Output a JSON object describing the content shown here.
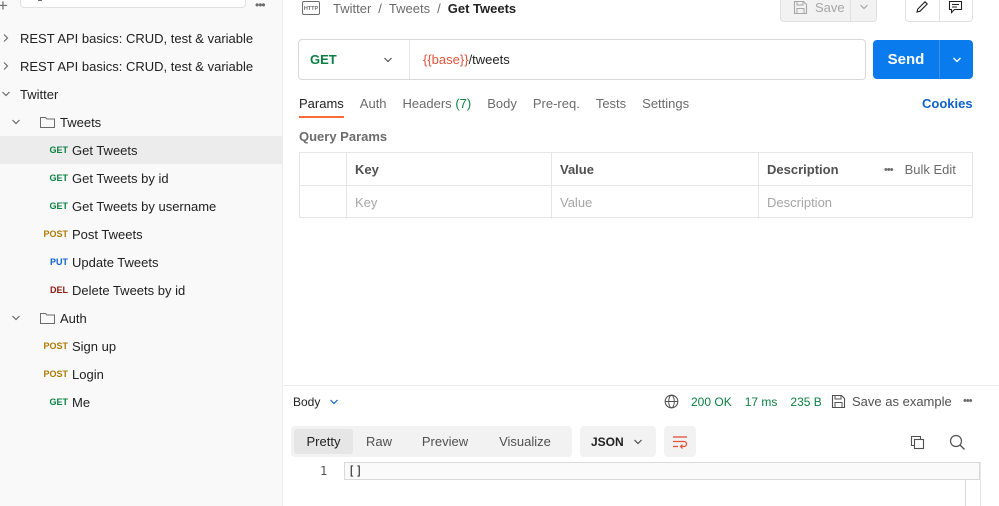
{
  "sidebar": {
    "collections": [
      {
        "label": "REST API basics: CRUD, test & variable"
      },
      {
        "label": "REST API basics: CRUD, test & variable"
      },
      {
        "label": "Twitter"
      }
    ],
    "folders": [
      {
        "label": "Tweets"
      },
      {
        "label": "Auth"
      }
    ],
    "requests": [
      {
        "method": "GET",
        "label": "Get Tweets"
      },
      {
        "method": "GET",
        "label": "Get Tweets by id"
      },
      {
        "method": "GET",
        "label": "Get Tweets by username"
      },
      {
        "method": "POST",
        "label": "Post Tweets"
      },
      {
        "method": "PUT",
        "label": "Update Tweets"
      },
      {
        "method": "DEL",
        "label": "Delete Tweets by id"
      },
      {
        "method": "POST",
        "label": "Sign up"
      },
      {
        "method": "POST",
        "label": "Login"
      },
      {
        "method": "GET",
        "label": "Me"
      }
    ]
  },
  "header": {
    "breadcrumb": [
      "Twitter",
      "Tweets",
      "Get Tweets"
    ],
    "save_label": "Save"
  },
  "request": {
    "method": "GET",
    "url_var": "{{base}}",
    "url_path": "/tweets",
    "send_label": "Send"
  },
  "tabs": {
    "params": "Params",
    "auth": "Auth",
    "headers": "Headers",
    "headers_count": "(7)",
    "body": "Body",
    "prereq": "Pre-req.",
    "tests": "Tests",
    "settings": "Settings",
    "cookies": "Cookies"
  },
  "query_params": {
    "title": "Query Params",
    "columns": [
      "Key",
      "Value",
      "Description"
    ],
    "bulk_edit": "Bulk Edit",
    "placeholders": [
      "Key",
      "Value",
      "Description"
    ]
  },
  "response": {
    "body_label": "Body",
    "status": "200 OK",
    "time": "17 ms",
    "size": "235 B",
    "save_example": "Save as example",
    "view_tabs": [
      "Pretty",
      "Raw",
      "Preview",
      "Visualize"
    ],
    "format": "JSON",
    "line_number": "1",
    "code": "[]"
  },
  "colors": {
    "accent": "#ff6c37",
    "send": "#097bed",
    "get": "#0b8043",
    "post": "#ad7a03",
    "put": "#0f62c9",
    "delete": "#8e1a10",
    "url_variable": "#e0533a"
  }
}
